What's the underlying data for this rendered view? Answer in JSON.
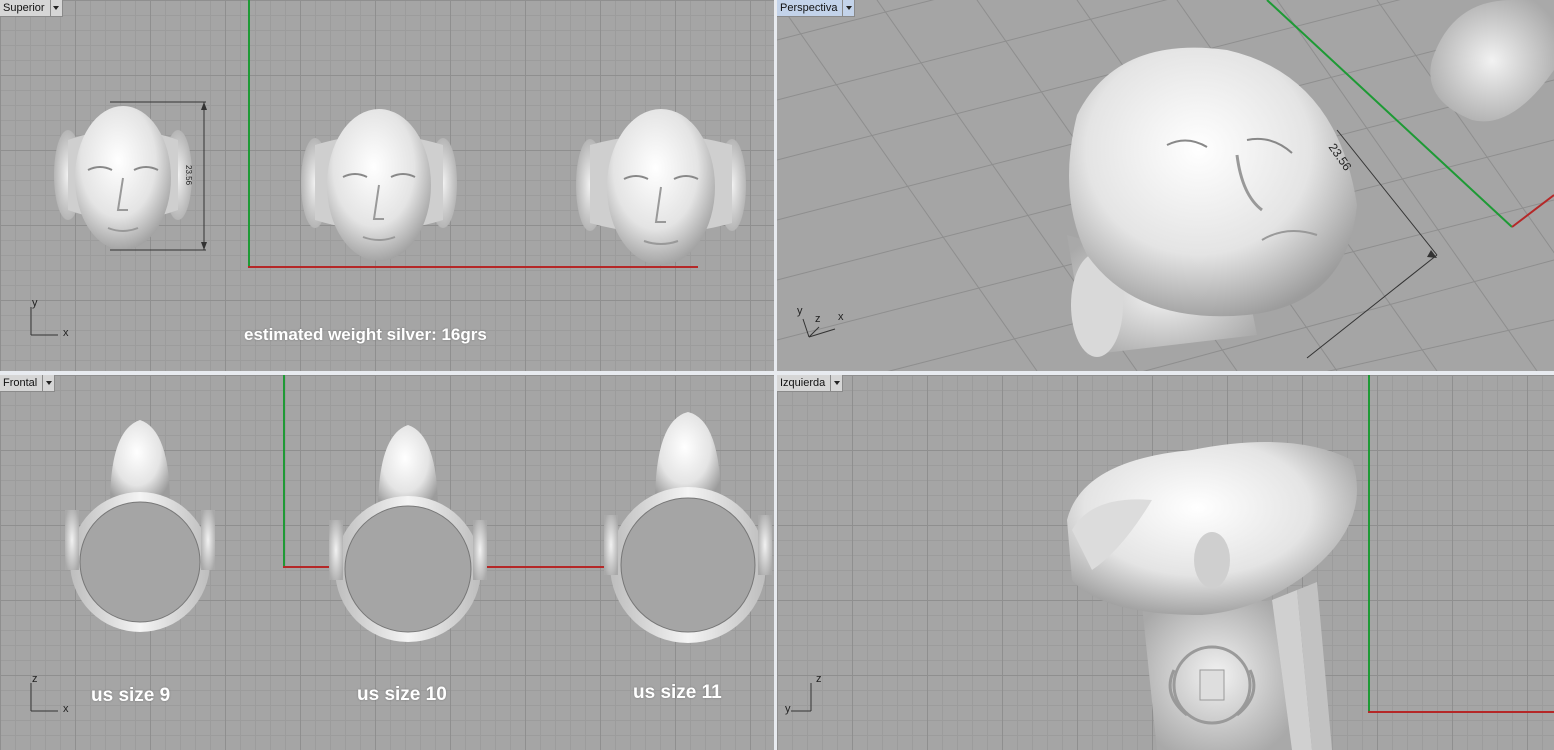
{
  "viewports": {
    "top": {
      "label": "Superior",
      "overlay": "estimated weight silver: 16grs",
      "dimension": "23.56",
      "axes": {
        "v": "y",
        "h": "x"
      }
    },
    "perspective": {
      "label": "Perspectiva",
      "dimension": "23.56",
      "axes": {
        "v": "y",
        "m": "z",
        "h": "x"
      }
    },
    "front": {
      "label": "Frontal",
      "sizes": [
        "us size 9",
        "us size 10",
        "us size 11"
      ],
      "axes": {
        "v": "z",
        "h": "x"
      }
    },
    "left": {
      "label": "Izquierda",
      "axes": {
        "v": "z",
        "h": "y"
      }
    }
  },
  "colors": {
    "active_tab": "#c3d3ea",
    "grid_bg": "#a5a5a5",
    "x_axis": "#b52828",
    "y_axis": "#1e9a35",
    "model": "#e6e6e6"
  }
}
